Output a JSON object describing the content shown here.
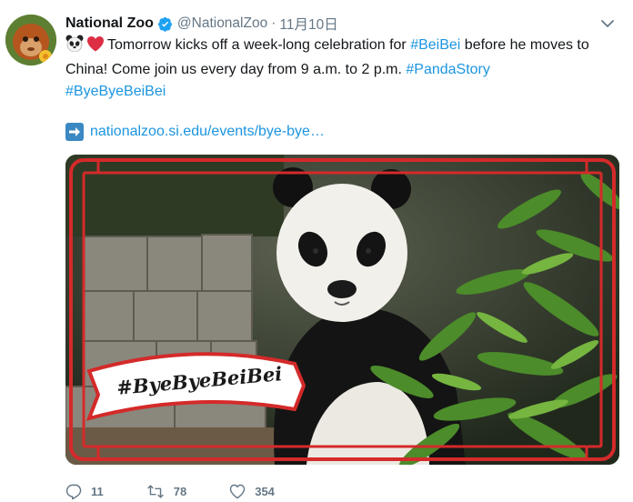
{
  "tweet": {
    "display_name": "National Zoo",
    "handle": "@NationalZoo",
    "separator": "·",
    "date": "11月10日",
    "text_pre": "Tomorrow kicks off a week-long celebration for ",
    "hashtag_beibei": "#BeiBei",
    "text_mid": " before he moves to China! Come join us every day from 9 a.m. to 2 p.m. ",
    "hashtag_pandastory": "#PandaStory",
    "hashtag_byebyebeibei": "#ByeByeBeiBei",
    "link": "nationalzoo.si.edu/events/bye-bye…"
  },
  "media": {
    "banner_text": "#ByeByeBeiBei"
  },
  "actions": {
    "replies": "11",
    "retweets": "78",
    "likes": "354"
  },
  "icons": {
    "verified": "verified-badge-icon",
    "caret": "chevron-down-icon",
    "emoji_1": "panda-face-icon",
    "emoji_2": "red-heart-icon",
    "link_prefix": "right-arrow-icon",
    "reply": "reply-icon",
    "retweet": "retweet-icon",
    "like": "heart-outline-icon"
  },
  "colors": {
    "link": "#1b95e0",
    "frame_red": "#d42a2a",
    "muted": "#657786"
  }
}
